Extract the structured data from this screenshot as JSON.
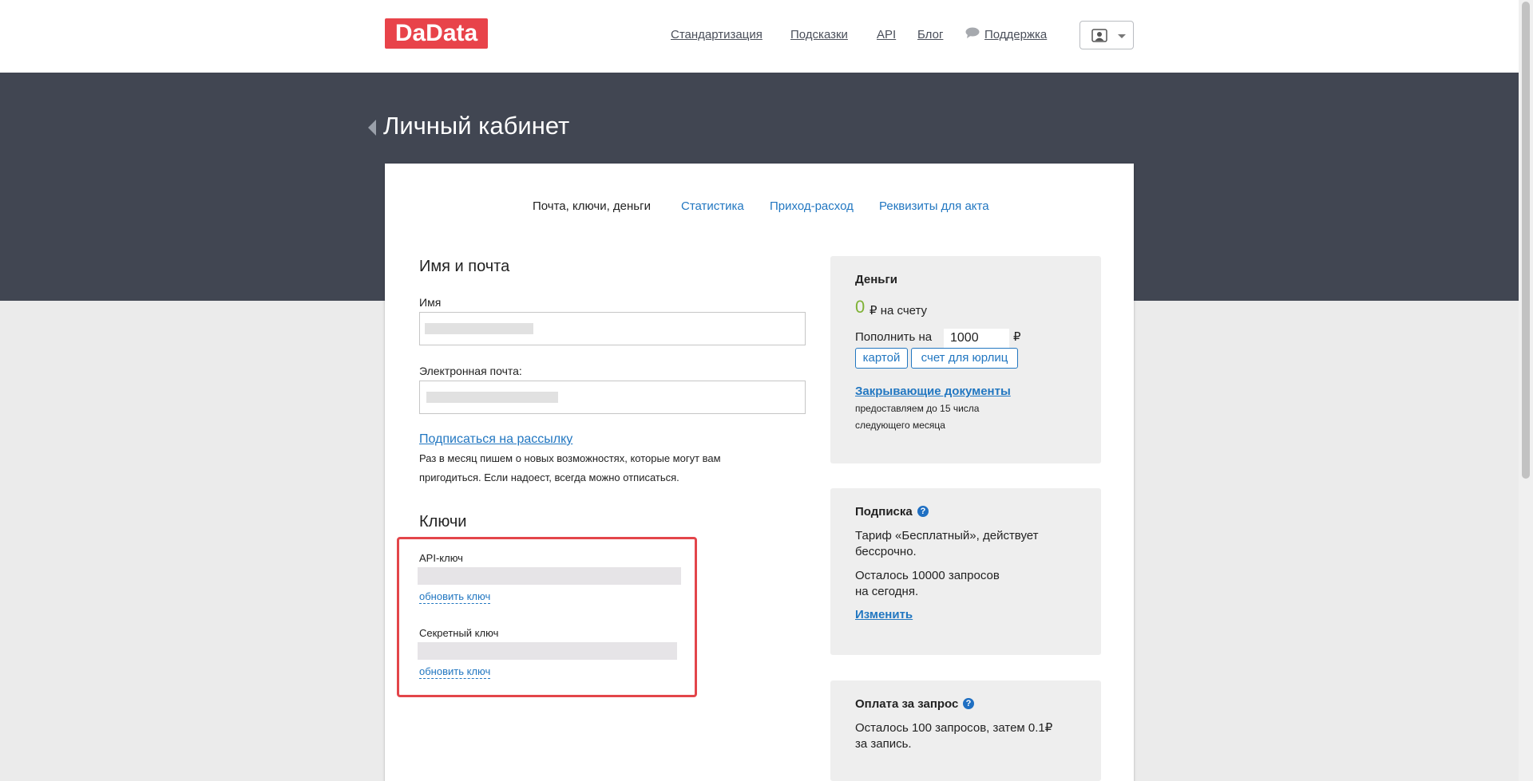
{
  "header": {
    "logo": "DaData",
    "nav": [
      "Стандартизация",
      "Подсказки",
      "API",
      "Блог",
      "Поддержка"
    ]
  },
  "page": {
    "title": "Личный кабинет"
  },
  "tabs": [
    "Почта, ключи, деньги",
    "Статистика",
    "Приход-расход",
    "Реквизиты для акта"
  ],
  "profile": {
    "heading": "Имя и почта",
    "name_label": "Имя",
    "email_label": "Электронная почта:",
    "subscribe_link": "Подписаться на рассылку",
    "subscribe_note_1": "Раз в месяц пишем о новых возможностях, которые могут вам",
    "subscribe_note_2": "пригодиться. Если надоест, всегда можно отписаться."
  },
  "keys": {
    "heading": "Ключи",
    "api_label": "API-ключ",
    "secret_label": "Секретный ключ",
    "refresh_link": "обновить ключ"
  },
  "money": {
    "title": "Деньги",
    "balance": "0",
    "balance_suffix": "₽ на счету",
    "topup_label": "Пополнить на",
    "topup_value": "1000",
    "currency": "₽",
    "btn_card": "картой",
    "btn_invoice": "счет для юрлиц",
    "docs_link": "Закрывающие документы",
    "docs_note_1": "предоставляем до 15 числа",
    "docs_note_2": "следующего месяца"
  },
  "subscription": {
    "title": "Подписка",
    "tariff_1": "Тариф «Бесплатный», действует",
    "tariff_2": "бессрочно.",
    "remaining_1": "Осталось 10000 запросов",
    "remaining_2": "на сегодня.",
    "change_link": "Изменить"
  },
  "per_request": {
    "title": "Оплата за запрос",
    "text_1": "Осталось 100 запросов, затем 0.1₽",
    "text_2": "за запись."
  },
  "colors": {
    "brand": "#e8434a",
    "header_band": "#414652",
    "link": "#2277c1",
    "balance": "#7fb236",
    "highlight": "#e3454a"
  }
}
